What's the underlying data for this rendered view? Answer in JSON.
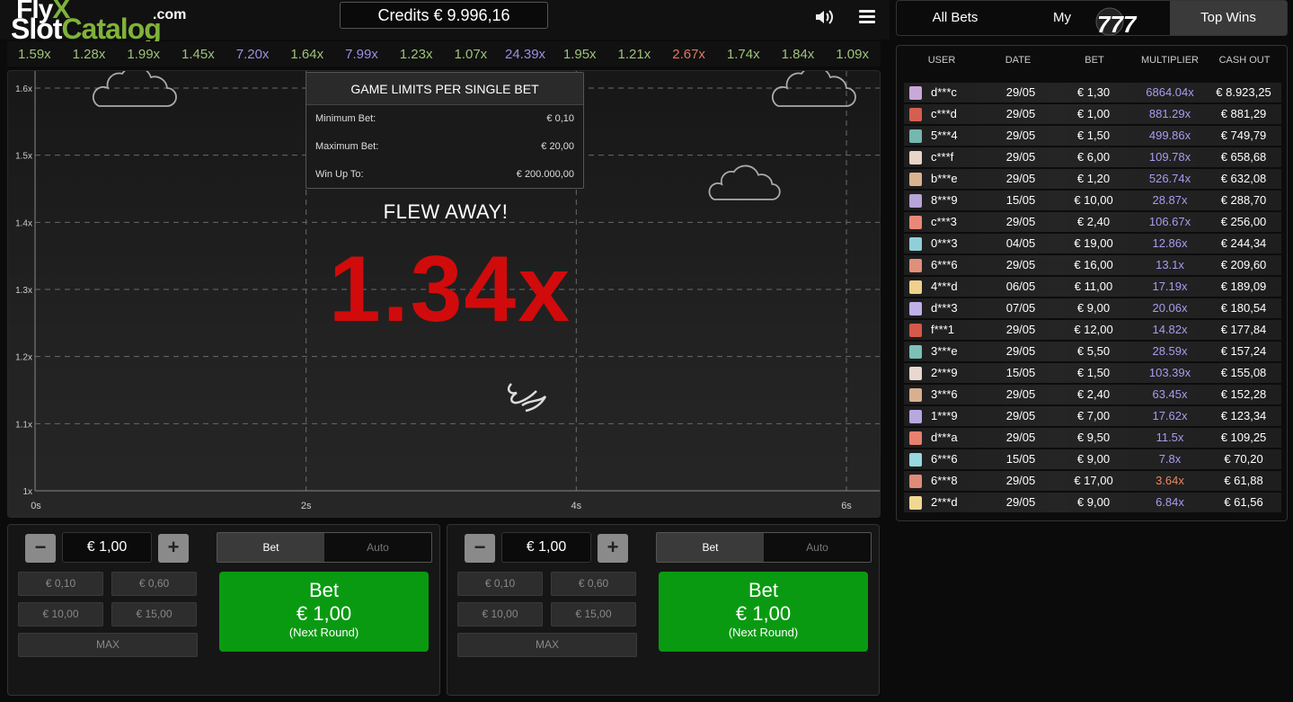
{
  "logo": {
    "fly": "Fly",
    "x": "X",
    "slot": "Slot",
    "catalog": "Catalog",
    "com": ".com"
  },
  "credits": "Credits € 9.996,16",
  "icons": {
    "sound": "speaker-icon",
    "menu": "hamburger-menu-icon"
  },
  "history": [
    {
      "v": "1.59x",
      "c": "#9ec27a"
    },
    {
      "v": "1.28x",
      "c": "#9ec27a"
    },
    {
      "v": "1.99x",
      "c": "#9ec27a"
    },
    {
      "v": "1.45x",
      "c": "#9ec27a"
    },
    {
      "v": "7.20x",
      "c": "#9b8fe0"
    },
    {
      "v": "1.64x",
      "c": "#9ec27a"
    },
    {
      "v": "7.99x",
      "c": "#9b8fe0"
    },
    {
      "v": "1.23x",
      "c": "#9ec27a"
    },
    {
      "v": "1.07x",
      "c": "#9ec27a"
    },
    {
      "v": "24.39x",
      "c": "#9b8fe0"
    },
    {
      "v": "1.95x",
      "c": "#9ec27a"
    },
    {
      "v": "1.21x",
      "c": "#9ec27a"
    },
    {
      "v": "2.67x",
      "c": "#e07a5f"
    },
    {
      "v": "1.74x",
      "c": "#9ec27a"
    },
    {
      "v": "1.84x",
      "c": "#9ec27a"
    },
    {
      "v": "1.09x",
      "c": "#9ec27a"
    }
  ],
  "graph": {
    "y_ticks": [
      "1.6x",
      "1.5x",
      "1.4x",
      "1.3x",
      "1.2x",
      "1.1x",
      "1x"
    ],
    "x_ticks": [
      "0s",
      "2s",
      "4s",
      "6s"
    ]
  },
  "limits": {
    "title": "GAME LIMITS PER SINGLE BET",
    "rows": [
      {
        "label": "Minimum Bet:",
        "value": "€ 0,10"
      },
      {
        "label": "Maximum Bet:",
        "value": "€ 20,00"
      },
      {
        "label": "Win Up To:",
        "value": "€ 200.000,00"
      }
    ]
  },
  "round": {
    "status": "FLEW AWAY!",
    "multiplier": "1.34x"
  },
  "panels": [
    {
      "minus": "−",
      "plus": "+",
      "amount": "€ 1,00",
      "tab_bet": "Bet",
      "tab_auto": "Auto",
      "chips": [
        "€ 0,10",
        "€ 0,60",
        "€ 10,00",
        "€ 15,00"
      ],
      "max": "MAX",
      "bet_l1": "Bet",
      "bet_l2": "€ 1,00",
      "bet_l3": "(Next Round)"
    },
    {
      "minus": "−",
      "plus": "+",
      "amount": "€ 1,00",
      "tab_bet": "Bet",
      "tab_auto": "Auto",
      "chips": [
        "€ 0,10",
        "€ 0,60",
        "€ 10,00",
        "€ 15,00"
      ],
      "max": "MAX",
      "bet_l1": "Bet",
      "bet_l2": "€ 1,00",
      "bet_l3": "(Next Round)"
    }
  ],
  "tabs_right": {
    "all": "All Bets",
    "my": "My",
    "top": "Top Wins",
    "overlay": "777"
  },
  "table": {
    "headers": {
      "user": "USER",
      "date": "DATE",
      "bet": "BET",
      "mult": "MULTIPLIER",
      "cash": "CASH OUT"
    },
    "rows": [
      {
        "user": "d***c",
        "date": "29/05",
        "bet": "€ 1,30",
        "mult": "6864.04x",
        "cash": "€ 8.923,25",
        "mc": "#a89cf0",
        "av": "#c9a7d8"
      },
      {
        "user": "c***d",
        "date": "29/05",
        "bet": "€ 1,00",
        "mult": "881.29x",
        "cash": "€ 881,29",
        "mc": "#a89cf0",
        "av": "#d55f4e"
      },
      {
        "user": "5***4",
        "date": "29/05",
        "bet": "€ 1,50",
        "mult": "499.86x",
        "cash": "€ 749,79",
        "mc": "#a89cf0",
        "av": "#74b8b0"
      },
      {
        "user": "c***f",
        "date": "29/05",
        "bet": "€ 6,00",
        "mult": "109.78x",
        "cash": "€ 658,68",
        "mc": "#a89cf0",
        "av": "#e8d4c8"
      },
      {
        "user": "b***e",
        "date": "29/05",
        "bet": "€ 1,20",
        "mult": "526.74x",
        "cash": "€ 632,08",
        "mc": "#a89cf0",
        "av": "#d9b48f"
      },
      {
        "user": "8***9",
        "date": "15/05",
        "bet": "€ 10,00",
        "mult": "28.87x",
        "cash": "€ 288,70",
        "mc": "#a89cf0",
        "av": "#b7a4d8"
      },
      {
        "user": "c***3",
        "date": "29/05",
        "bet": "€ 2,40",
        "mult": "106.67x",
        "cash": "€ 256,00",
        "mc": "#a89cf0",
        "av": "#e98878"
      },
      {
        "user": "0***3",
        "date": "04/05",
        "bet": "€ 19,00",
        "mult": "12.86x",
        "cash": "€ 244,34",
        "mc": "#a89cf0",
        "av": "#8fd0d8"
      },
      {
        "user": "6***6",
        "date": "29/05",
        "bet": "€ 16,00",
        "mult": "13.1x",
        "cash": "€ 209,60",
        "mc": "#a89cf0",
        "av": "#e0907a"
      },
      {
        "user": "4***d",
        "date": "06/05",
        "bet": "€ 11,00",
        "mult": "17.19x",
        "cash": "€ 189,09",
        "mc": "#a89cf0",
        "av": "#f0d08a"
      },
      {
        "user": "d***3",
        "date": "07/05",
        "bet": "€ 9,00",
        "mult": "20.06x",
        "cash": "€ 180,54",
        "mc": "#a89cf0",
        "av": "#c0b0e8"
      },
      {
        "user": "f***1",
        "date": "29/05",
        "bet": "€ 12,00",
        "mult": "14.82x",
        "cash": "€ 177,84",
        "mc": "#a89cf0",
        "av": "#d5584a"
      },
      {
        "user": "3***e",
        "date": "29/05",
        "bet": "€ 5,50",
        "mult": "28.59x",
        "cash": "€ 157,24",
        "mc": "#a89cf0",
        "av": "#7cc0b8"
      },
      {
        "user": "2***9",
        "date": "15/05",
        "bet": "€ 1,50",
        "mult": "103.39x",
        "cash": "€ 155,08",
        "mc": "#a89cf0",
        "av": "#e8d8d0"
      },
      {
        "user": "3***6",
        "date": "29/05",
        "bet": "€ 2,40",
        "mult": "63.45x",
        "cash": "€ 152,28",
        "mc": "#a89cf0",
        "av": "#d8b090"
      },
      {
        "user": "1***9",
        "date": "29/05",
        "bet": "€ 7,00",
        "mult": "17.62x",
        "cash": "€ 123,34",
        "mc": "#a89cf0",
        "av": "#b8a8e0"
      },
      {
        "user": "d***a",
        "date": "29/05",
        "bet": "€ 9,50",
        "mult": "11.5x",
        "cash": "€ 109,25",
        "mc": "#a89cf0",
        "av": "#e88070"
      },
      {
        "user": "6***6",
        "date": "15/05",
        "bet": "€ 9,00",
        "mult": "7.8x",
        "cash": "€ 70,20",
        "mc": "#a89cf0",
        "av": "#98d8e0"
      },
      {
        "user": "6***8",
        "date": "29/05",
        "bet": "€ 17,00",
        "mult": "3.64x",
        "cash": "€ 61,88",
        "mc": "#e88a60",
        "av": "#e08a78"
      },
      {
        "user": "2***d",
        "date": "29/05",
        "bet": "€ 9,00",
        "mult": "6.84x",
        "cash": "€ 61,56",
        "mc": "#a89cf0",
        "av": "#f0d890"
      }
    ]
  }
}
